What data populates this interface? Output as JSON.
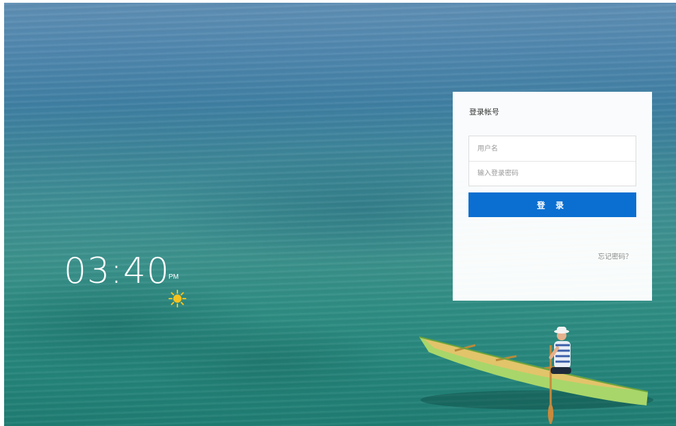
{
  "clock": {
    "time": "03:40",
    "ampm": "PM",
    "weather_icon": "sun-icon"
  },
  "login": {
    "title": "登录帐号",
    "username_placeholder": "用户名",
    "password_placeholder": "输入登录密码",
    "submit_label": "登 录",
    "forgot_label": "忘记密码？"
  },
  "colors": {
    "accent": "#0a6fd1",
    "sun": "#f7c21e"
  }
}
